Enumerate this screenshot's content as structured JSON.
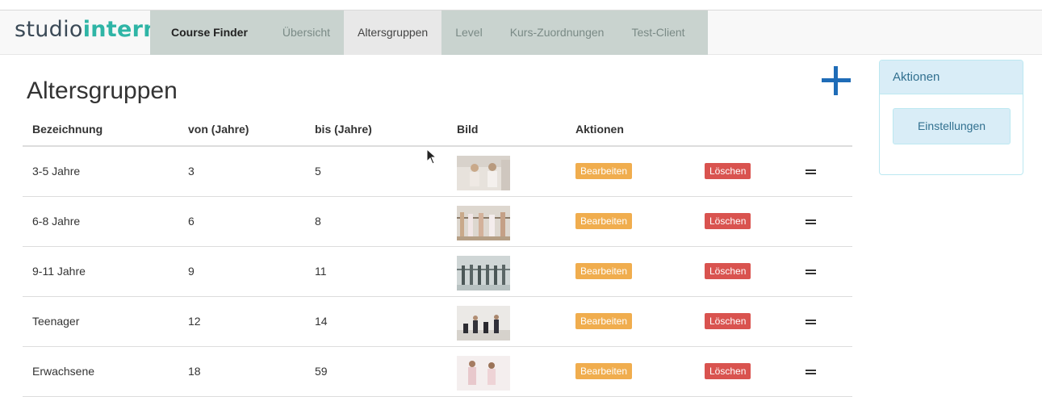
{
  "app": {
    "brand_part1": "studio",
    "brand_part2": "intern"
  },
  "nav": {
    "items": [
      {
        "label": "Course Finder"
      },
      {
        "label": "Übersicht"
      },
      {
        "label": "Altersgruppen"
      },
      {
        "label": "Level"
      },
      {
        "label": "Kurs-Zuordnungen"
      },
      {
        "label": "Test-Client"
      }
    ],
    "active": "Altersgruppen"
  },
  "page": {
    "title": "Altersgruppen",
    "add_icon": "plus-icon"
  },
  "table": {
    "headers": [
      "Bezeichnung",
      "von (Jahre)",
      "bis (Jahre)",
      "Bild",
      "Aktionen"
    ],
    "edit_label": "Bearbeiten",
    "delete_label": "Löschen",
    "rows": [
      {
        "name": "3-5 Jahre",
        "from": "3",
        "to": "5"
      },
      {
        "name": "6-8 Jahre",
        "from": "6",
        "to": "8"
      },
      {
        "name": "9-11 Jahre",
        "from": "9",
        "to": "11"
      },
      {
        "name": "Teenager",
        "from": "12",
        "to": "14"
      },
      {
        "name": "Erwachsene",
        "from": "18",
        "to": "59"
      }
    ]
  },
  "sidebar": {
    "title": "Aktionen",
    "button": "Einstellungen"
  },
  "colors": {
    "brand_teal": "#2fb5a6",
    "add_blue": "#1f6cb7",
    "edit_orange": "#f0ad4e",
    "delete_red": "#d9534f",
    "panel_blue": "#d9edf7"
  }
}
